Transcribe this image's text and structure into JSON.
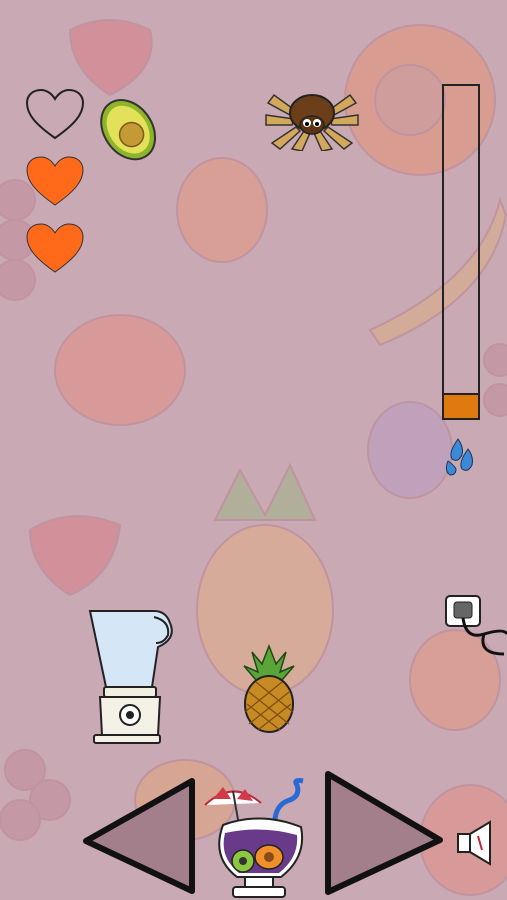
{
  "game": {
    "lives": {
      "max": 3,
      "remaining": 2
    },
    "blend_level": 0.07,
    "falling_items": [
      "avocado-icon",
      "spider-icon",
      "pineapple-icon"
    ],
    "colors": {
      "background": "#c9a9b3",
      "heart_full": "#ff6a1a",
      "meter_fill": "#df7a10",
      "arrow_fill": "#a27f8a"
    }
  },
  "controls": {
    "left": "chevron-left-icon",
    "right": "chevron-right-icon",
    "sound": "speaker-icon"
  }
}
